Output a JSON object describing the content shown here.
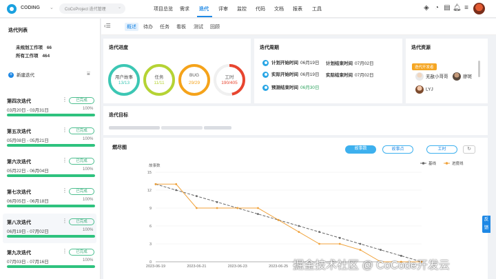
{
  "topbar": {
    "brand": "CODING",
    "project": "CoCoProject 迭代管理",
    "nav": [
      "项目总览",
      "需求",
      "迭代",
      "评审",
      "监控",
      "代码",
      "文档",
      "报表",
      "工具"
    ],
    "active_nav": "迭代",
    "icons": [
      "layers-icon",
      "chart-pie-icon",
      "briefcase-icon",
      "bell-icon",
      "sliders-icon",
      "user-avatar"
    ]
  },
  "sidebar": {
    "title": "迭代列表",
    "unplanned_label": "未规划工作项",
    "unplanned_count": "66",
    "all_label": "所有工作项",
    "all_count": "464",
    "new_iteration": "新建迭代",
    "iterations": [
      {
        "name": "第四次迭代",
        "date": "03月20日 - 03月31日",
        "status": "已完成",
        "progress": "100%",
        "progress_value": 1.0
      },
      {
        "name": "第五次迭代",
        "date": "05月08日 - 05月21日",
        "status": "已完成",
        "progress": "100%",
        "progress_value": 1.0
      },
      {
        "name": "第六次迭代",
        "date": "05月22日 - 06月04日",
        "status": "已完成",
        "progress": "100%",
        "progress_value": 1.0
      },
      {
        "name": "第七次迭代",
        "date": "06月05日 - 06月18日",
        "status": "已完成",
        "progress": "100%",
        "progress_value": 1.0
      },
      {
        "name": "第八次迭代",
        "date": "06月19日 - 07月02日",
        "status": "已完成",
        "progress": "100%",
        "progress_value": 1.0
      },
      {
        "name": "第九次迭代",
        "date": "07月03日 - 07月16日",
        "status": "已完成",
        "progress": "100%",
        "progress_value": 1.0
      }
    ]
  },
  "subtabs": [
    "概述",
    "待办",
    "任务",
    "看板",
    "测试",
    "回顾"
  ],
  "active_subtab": "概述",
  "progress_card": {
    "title": "迭代进度",
    "rings": [
      {
        "label": "用户故事",
        "value": "13/13",
        "fraction": 1.0,
        "color": "#3cc7b4"
      },
      {
        "label": "任务",
        "value": "11/11",
        "fraction": 1.0,
        "color": "#b5d334"
      },
      {
        "label": "BUG",
        "value": "29/29",
        "fraction": 1.0,
        "color": "#f5a31a"
      },
      {
        "label": "工时",
        "value": "190/405",
        "fraction": 0.47,
        "color": "#e8452f"
      }
    ]
  },
  "period_card": {
    "title": "迭代周期",
    "plan_start_label": "计划开始时间",
    "plan_start": "06月19日",
    "plan_end_label": "计划结束时间",
    "plan_end": "07月02日",
    "actual_start_label": "实际开始时间",
    "actual_start": "06月19日",
    "actual_end_label": "实际结束时间",
    "actual_end": "07月02日",
    "forecast_label": "预测结束时间",
    "forecast": "06月30日"
  },
  "resource_card": {
    "title": "迭代资源",
    "badge": "迭代开发者",
    "people": [
      "无敌小哥哥",
      "廖斑",
      "LYJ"
    ]
  },
  "goal_card": {
    "title": "迭代目标"
  },
  "burndown": {
    "title": "燃尽图",
    "buttons": [
      "故事数",
      "故事点",
      "工时"
    ],
    "active_button": "故事数",
    "refresh_icon": "refresh-icon"
  },
  "chart_data": {
    "type": "line",
    "ylabel": "故事数",
    "ylim": [
      0,
      15
    ],
    "yticks": [
      0,
      3,
      6,
      9,
      12,
      15
    ],
    "x": [
      "2023-06-19",
      "2023-06-20",
      "2023-06-21",
      "2023-06-22",
      "2023-06-23",
      "2023-06-24",
      "2023-06-25",
      "2023-06-26",
      "2023-06-27",
      "2023-06-28",
      "2023-06-29",
      "2023-06-30",
      "2023-07-01",
      "2023-07-02"
    ],
    "xtick_labels": [
      "2023-06-19",
      "2023-06-21",
      "2023-06-23",
      "2023-06-25"
    ],
    "legend_position": "top-right",
    "series": [
      {
        "name": "基线",
        "color": "#666666",
        "dashed": true,
        "values": [
          13,
          12,
          11,
          10,
          9,
          8,
          7,
          6,
          5,
          4,
          3,
          2,
          1,
          0
        ]
      },
      {
        "name": "进度线",
        "color": "#f0a23b",
        "dashed": false,
        "values": [
          13,
          13,
          9,
          9,
          9,
          9,
          7,
          5,
          3,
          3,
          2,
          0,
          0,
          0
        ]
      }
    ]
  },
  "feedback": "反馈",
  "watermark": "掘金技术社区 @ CoCode开发云"
}
